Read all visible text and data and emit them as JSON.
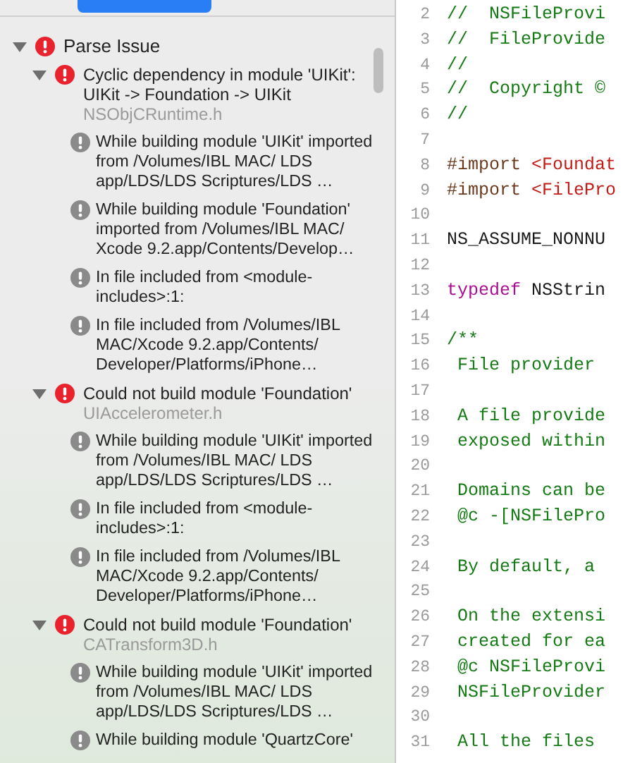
{
  "issues": {
    "groups": [
      {
        "title": "Parse Issue",
        "expanded": true,
        "children": [
          {
            "title": "Cyclic dependency in module 'UIKit': UIKit -> Foundation -> UIKit",
            "file": "NSObjCRuntime.h",
            "expanded": true,
            "notes": [
              "While building module 'UIKit' imported from /Volumes/IBL MAC/ LDS app/LDS/LDS Scriptures/LDS …",
              "While building module 'Foundation' imported from /Volumes/IBL MAC/ Xcode 9.2.app/Contents/Develop…",
              "In file included from <module-includes>:1:",
              "In file included from /Volumes/IBL MAC/Xcode 9.2.app/Contents/ Developer/Platforms/iPhone…"
            ]
          },
          {
            "title": "Could not build module 'Foundation'",
            "file": "UIAccelerometer.h",
            "expanded": true,
            "notes": [
              "While building module 'UIKit' imported from /Volumes/IBL MAC/ LDS app/LDS/LDS Scriptures/LDS …",
              "In file included from <module-includes>:1:",
              "In file included from /Volumes/IBL MAC/Xcode 9.2.app/Contents/ Developer/Platforms/iPhone…"
            ]
          },
          {
            "title": "Could not build module 'Foundation'",
            "file": "CATransform3D.h",
            "expanded": true,
            "notes": [
              "While building module 'UIKit' imported from /Volumes/IBL MAC/ LDS app/LDS/LDS Scriptures/LDS …",
              "While building module 'QuartzCore'"
            ]
          }
        ]
      }
    ]
  },
  "editor": {
    "lines": [
      {
        "number": "2",
        "segments": [
          {
            "text": "//  NSFileProvi",
            "kind": "comment"
          }
        ]
      },
      {
        "number": "3",
        "segments": [
          {
            "text": "//  FileProvide",
            "kind": "comment"
          }
        ]
      },
      {
        "number": "4",
        "segments": [
          {
            "text": "//",
            "kind": "comment"
          }
        ]
      },
      {
        "number": "5",
        "segments": [
          {
            "text": "//  Copyright ©",
            "kind": "comment"
          }
        ]
      },
      {
        "number": "6",
        "segments": [
          {
            "text": "//",
            "kind": "comment"
          }
        ]
      },
      {
        "number": "7"
      },
      {
        "number": "8",
        "segments": [
          {
            "text": "#import",
            "kind": "preprocessor"
          },
          {
            "text": "<Foundat",
            "kind": "string"
          }
        ]
      },
      {
        "number": "9",
        "segments": [
          {
            "text": "#import",
            "kind": "preprocessor"
          },
          {
            "text": "<FilePro",
            "kind": "string"
          }
        ]
      },
      {
        "number": "10"
      },
      {
        "number": "11",
        "segments": [
          {
            "text": "NS_ASSUME_NONNU",
            "kind": "plain"
          }
        ]
      },
      {
        "number": "12"
      },
      {
        "number": "13",
        "segments": [
          {
            "text": "typedef",
            "kind": "keyword"
          },
          {
            "text": "NSStrin",
            "kind": "plain"
          }
        ]
      },
      {
        "number": "14"
      },
      {
        "number": "15",
        "segments": [
          {
            "text": "/**",
            "kind": "comment"
          }
        ]
      },
      {
        "number": "16",
        "segments": [
          {
            "text": " File provider",
            "kind": "comment"
          }
        ]
      },
      {
        "number": "17"
      },
      {
        "number": "18",
        "segments": [
          {
            "text": " A file provide",
            "kind": "comment"
          }
        ]
      },
      {
        "number": "19",
        "segments": [
          {
            "text": " exposed within",
            "kind": "comment"
          }
        ]
      },
      {
        "number": "20"
      },
      {
        "number": "21",
        "segments": [
          {
            "text": " Domains can be",
            "kind": "comment"
          }
        ]
      },
      {
        "number": "22",
        "segments": [
          {
            "text": " @c -[NSFilePro",
            "kind": "comment"
          }
        ]
      },
      {
        "number": "23"
      },
      {
        "number": "24",
        "segments": [
          {
            "text": " By default, a",
            "kind": "comment"
          }
        ]
      },
      {
        "number": "25"
      },
      {
        "number": "26",
        "segments": [
          {
            "text": " On the extensi",
            "kind": "comment"
          }
        ]
      },
      {
        "number": "27",
        "segments": [
          {
            "text": " created for ea",
            "kind": "comment"
          }
        ]
      },
      {
        "number": "28",
        "segments": [
          {
            "text": " @c NSFileProvi",
            "kind": "comment"
          }
        ]
      },
      {
        "number": "29",
        "segments": [
          {
            "text": " NSFileProvider",
            "kind": "comment"
          }
        ]
      },
      {
        "number": "30"
      },
      {
        "number": "31",
        "segments": [
          {
            "text": " All the files",
            "kind": "comment"
          }
        ]
      }
    ]
  }
}
